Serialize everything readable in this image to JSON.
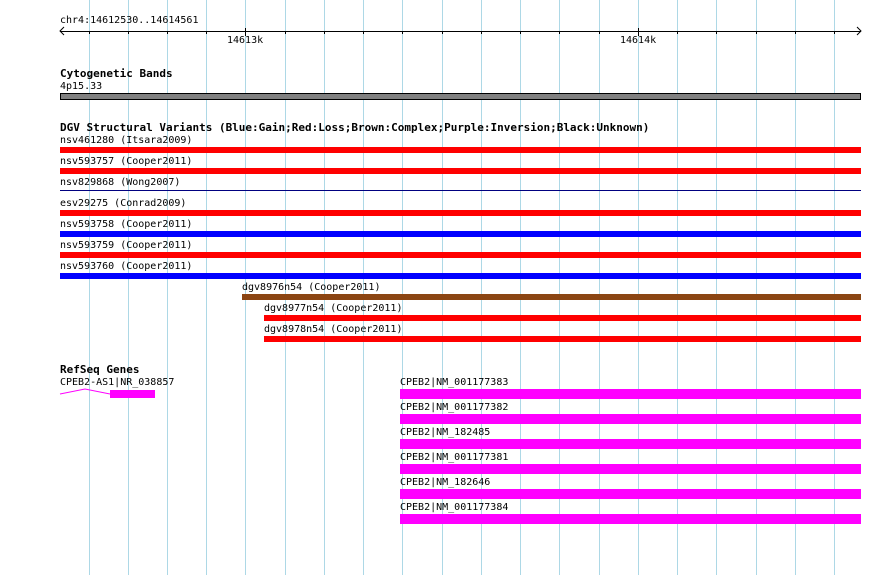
{
  "ruler": {
    "location": "chr4:14612530..14614561",
    "tick_labels": [
      "14613k",
      "14614k"
    ]
  },
  "cyto": {
    "title": "Cytogenetic Bands",
    "band": "4p15.33",
    "band_color": "#808080"
  },
  "dgv": {
    "title": "DGV Structural Variants (Blue:Gain;Red:Loss;Brown:Complex;Purple:Inversion;Black:Unknown)",
    "colors": {
      "loss": "#ff0000",
      "gain": "#0000ff",
      "complex": "#8b4513",
      "unknown": "#000080"
    },
    "items": [
      {
        "label": "nsv461280 (Itsara2009)",
        "type": "loss"
      },
      {
        "label": "nsv593757 (Cooper2011)",
        "type": "loss"
      },
      {
        "label": "nsv829868 (Wong2007)",
        "type": "unknown"
      },
      {
        "label": "esv29275 (Conrad2009)",
        "type": "loss"
      },
      {
        "label": "nsv593758 (Cooper2011)",
        "type": "gain"
      },
      {
        "label": "nsv593759 (Cooper2011)",
        "type": "loss"
      },
      {
        "label": "nsv593760 (Cooper2011)",
        "type": "gain"
      },
      {
        "label": "dgv8976n54 (Cooper2011)",
        "type": "complex"
      },
      {
        "label": "dgv8977n54 (Cooper2011)",
        "type": "loss"
      },
      {
        "label": "dgv8978n54 (Cooper2011)",
        "type": "loss"
      }
    ]
  },
  "refseq": {
    "title": "RefSeq Genes",
    "color": "#ff00ff",
    "antisense": "CPEB2-AS1|NR_038857",
    "transcripts": [
      "CPEB2|NM_001177383",
      "CPEB2|NM_001177382",
      "CPEB2|NM_182485",
      "CPEB2|NM_001177381",
      "CPEB2|NM_182646",
      "CPEB2|NM_001177384"
    ]
  }
}
